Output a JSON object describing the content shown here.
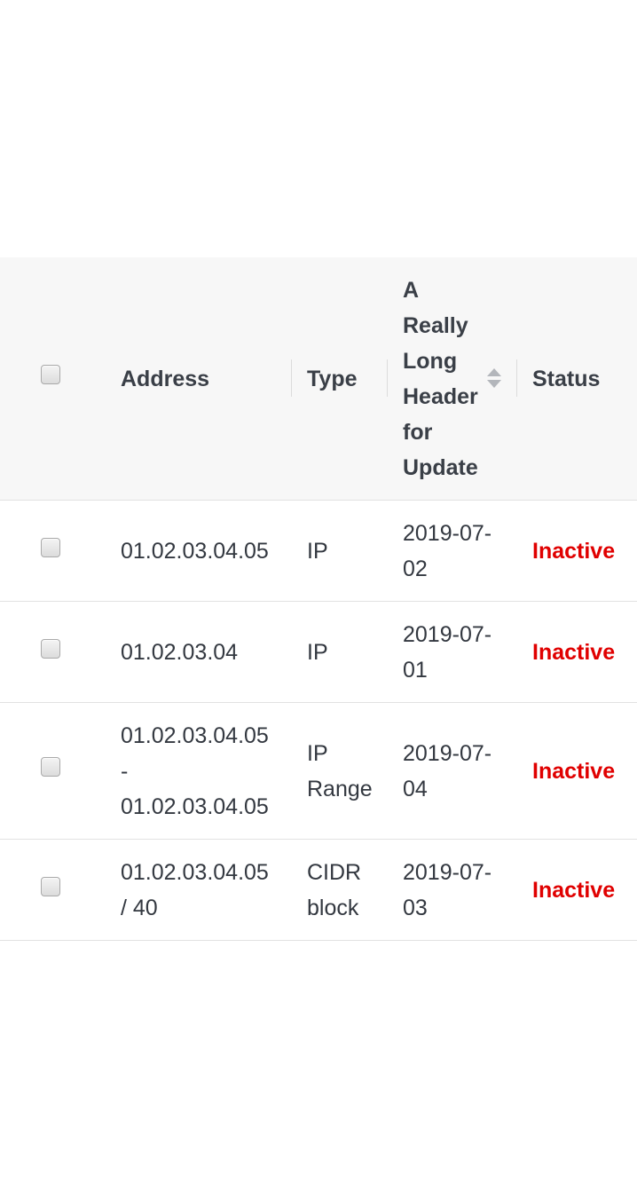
{
  "table": {
    "columns": {
      "address": "Address",
      "type": "Type",
      "updated_lines": [
        "A",
        "Really",
        "Long",
        "Header",
        "for",
        "Update"
      ],
      "status": "Status"
    },
    "rows": [
      {
        "address_lines": [
          "01.02.03.04.05"
        ],
        "type_lines": [
          "IP"
        ],
        "date_lines": [
          "2019-07-",
          "02"
        ],
        "status": "Inactive"
      },
      {
        "address_lines": [
          "01.02.03.04"
        ],
        "type_lines": [
          "IP"
        ],
        "date_lines": [
          "2019-07-",
          "01"
        ],
        "status": "Inactive"
      },
      {
        "address_lines": [
          "01.02.03.04.05",
          "-",
          "01.02.03.04.05"
        ],
        "type_lines": [
          "IP",
          "Range"
        ],
        "date_lines": [
          "2019-07-",
          "04"
        ],
        "status": "Inactive"
      },
      {
        "address_lines": [
          "01.02.03.04.05",
          "/ 40"
        ],
        "type_lines": [
          "CIDR",
          "block"
        ],
        "date_lines": [
          "2019-07-",
          "03"
        ],
        "status": "Inactive"
      }
    ],
    "colors": {
      "inactive": "#e00000",
      "header_bg": "#f7f7f7",
      "border": "#e2e2e2"
    },
    "sort_icon": "sort-up-down-icon"
  }
}
